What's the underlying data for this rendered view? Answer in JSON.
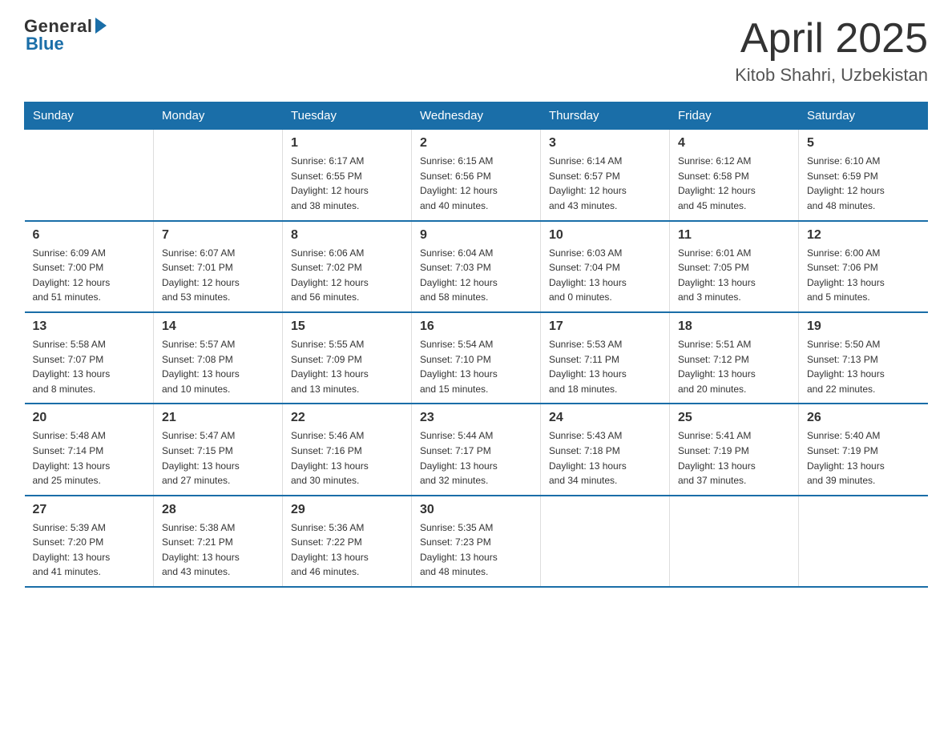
{
  "header": {
    "logo_general": "General",
    "logo_blue": "Blue",
    "month": "April 2025",
    "location": "Kitob Shahri, Uzbekistan"
  },
  "days_of_week": [
    "Sunday",
    "Monday",
    "Tuesday",
    "Wednesday",
    "Thursday",
    "Friday",
    "Saturday"
  ],
  "weeks": [
    [
      {
        "day": "",
        "info": ""
      },
      {
        "day": "",
        "info": ""
      },
      {
        "day": "1",
        "info": "Sunrise: 6:17 AM\nSunset: 6:55 PM\nDaylight: 12 hours\nand 38 minutes."
      },
      {
        "day": "2",
        "info": "Sunrise: 6:15 AM\nSunset: 6:56 PM\nDaylight: 12 hours\nand 40 minutes."
      },
      {
        "day": "3",
        "info": "Sunrise: 6:14 AM\nSunset: 6:57 PM\nDaylight: 12 hours\nand 43 minutes."
      },
      {
        "day": "4",
        "info": "Sunrise: 6:12 AM\nSunset: 6:58 PM\nDaylight: 12 hours\nand 45 minutes."
      },
      {
        "day": "5",
        "info": "Sunrise: 6:10 AM\nSunset: 6:59 PM\nDaylight: 12 hours\nand 48 minutes."
      }
    ],
    [
      {
        "day": "6",
        "info": "Sunrise: 6:09 AM\nSunset: 7:00 PM\nDaylight: 12 hours\nand 51 minutes."
      },
      {
        "day": "7",
        "info": "Sunrise: 6:07 AM\nSunset: 7:01 PM\nDaylight: 12 hours\nand 53 minutes."
      },
      {
        "day": "8",
        "info": "Sunrise: 6:06 AM\nSunset: 7:02 PM\nDaylight: 12 hours\nand 56 minutes."
      },
      {
        "day": "9",
        "info": "Sunrise: 6:04 AM\nSunset: 7:03 PM\nDaylight: 12 hours\nand 58 minutes."
      },
      {
        "day": "10",
        "info": "Sunrise: 6:03 AM\nSunset: 7:04 PM\nDaylight: 13 hours\nand 0 minutes."
      },
      {
        "day": "11",
        "info": "Sunrise: 6:01 AM\nSunset: 7:05 PM\nDaylight: 13 hours\nand 3 minutes."
      },
      {
        "day": "12",
        "info": "Sunrise: 6:00 AM\nSunset: 7:06 PM\nDaylight: 13 hours\nand 5 minutes."
      }
    ],
    [
      {
        "day": "13",
        "info": "Sunrise: 5:58 AM\nSunset: 7:07 PM\nDaylight: 13 hours\nand 8 minutes."
      },
      {
        "day": "14",
        "info": "Sunrise: 5:57 AM\nSunset: 7:08 PM\nDaylight: 13 hours\nand 10 minutes."
      },
      {
        "day": "15",
        "info": "Sunrise: 5:55 AM\nSunset: 7:09 PM\nDaylight: 13 hours\nand 13 minutes."
      },
      {
        "day": "16",
        "info": "Sunrise: 5:54 AM\nSunset: 7:10 PM\nDaylight: 13 hours\nand 15 minutes."
      },
      {
        "day": "17",
        "info": "Sunrise: 5:53 AM\nSunset: 7:11 PM\nDaylight: 13 hours\nand 18 minutes."
      },
      {
        "day": "18",
        "info": "Sunrise: 5:51 AM\nSunset: 7:12 PM\nDaylight: 13 hours\nand 20 minutes."
      },
      {
        "day": "19",
        "info": "Sunrise: 5:50 AM\nSunset: 7:13 PM\nDaylight: 13 hours\nand 22 minutes."
      }
    ],
    [
      {
        "day": "20",
        "info": "Sunrise: 5:48 AM\nSunset: 7:14 PM\nDaylight: 13 hours\nand 25 minutes."
      },
      {
        "day": "21",
        "info": "Sunrise: 5:47 AM\nSunset: 7:15 PM\nDaylight: 13 hours\nand 27 minutes."
      },
      {
        "day": "22",
        "info": "Sunrise: 5:46 AM\nSunset: 7:16 PM\nDaylight: 13 hours\nand 30 minutes."
      },
      {
        "day": "23",
        "info": "Sunrise: 5:44 AM\nSunset: 7:17 PM\nDaylight: 13 hours\nand 32 minutes."
      },
      {
        "day": "24",
        "info": "Sunrise: 5:43 AM\nSunset: 7:18 PM\nDaylight: 13 hours\nand 34 minutes."
      },
      {
        "day": "25",
        "info": "Sunrise: 5:41 AM\nSunset: 7:19 PM\nDaylight: 13 hours\nand 37 minutes."
      },
      {
        "day": "26",
        "info": "Sunrise: 5:40 AM\nSunset: 7:19 PM\nDaylight: 13 hours\nand 39 minutes."
      }
    ],
    [
      {
        "day": "27",
        "info": "Sunrise: 5:39 AM\nSunset: 7:20 PM\nDaylight: 13 hours\nand 41 minutes."
      },
      {
        "day": "28",
        "info": "Sunrise: 5:38 AM\nSunset: 7:21 PM\nDaylight: 13 hours\nand 43 minutes."
      },
      {
        "day": "29",
        "info": "Sunrise: 5:36 AM\nSunset: 7:22 PM\nDaylight: 13 hours\nand 46 minutes."
      },
      {
        "day": "30",
        "info": "Sunrise: 5:35 AM\nSunset: 7:23 PM\nDaylight: 13 hours\nand 48 minutes."
      },
      {
        "day": "",
        "info": ""
      },
      {
        "day": "",
        "info": ""
      },
      {
        "day": "",
        "info": ""
      }
    ]
  ]
}
